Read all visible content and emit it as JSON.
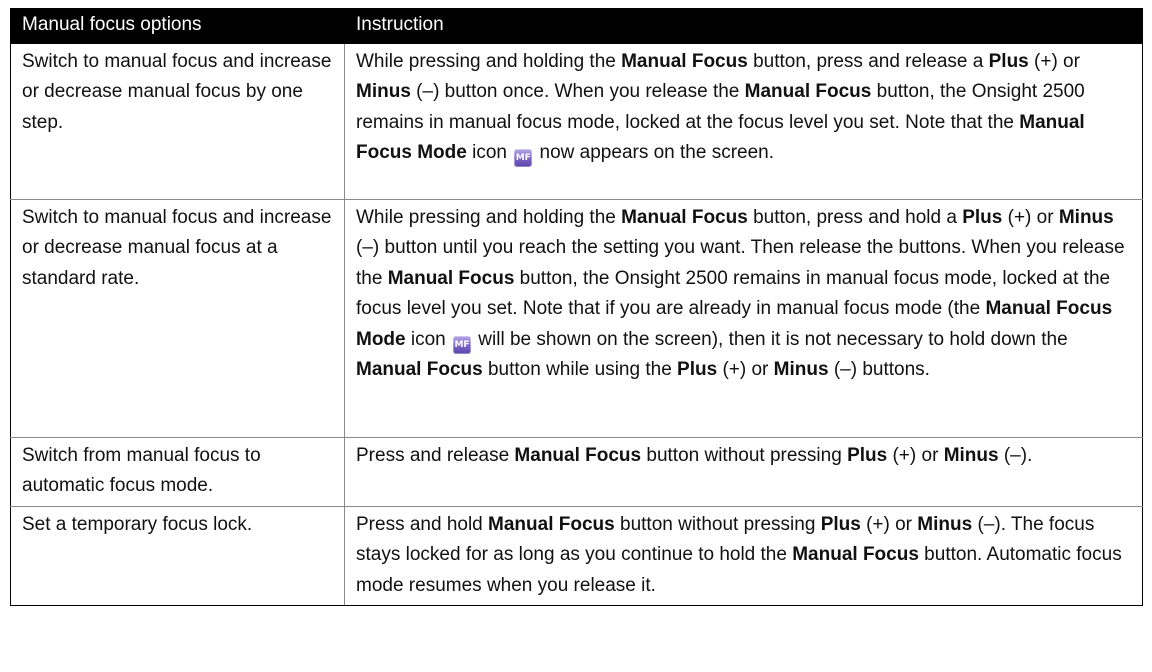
{
  "header": {
    "col1": "Manual focus options",
    "col2": "Instruction"
  },
  "icon_text": "MF",
  "rows": [
    {
      "option": "Switch to manual focus and increase or decrease manual focus by one step.",
      "t": [
        "While pressing and holding the ",
        "Manual Focus",
        " button, press and release a ",
        "Plus",
        " (+) or ",
        "Minus",
        " (–) button once. When you release the ",
        "Manual Focus",
        " button, the Onsight 2500 remains in manual focus mode, locked at the focus level you set. Note that the ",
        "Manual Focus Mode",
        " icon ",
        " now appears on the screen."
      ]
    },
    {
      "option": "Switch to manual focus and increase or decrease manual focus at a standard rate.",
      "t": [
        "While pressing and holding the ",
        "Manual Focus",
        " button, press and hold a ",
        "Plus",
        " (+) or ",
        "Minus",
        " (–) button until you reach the setting you want. Then release the buttons. When you release the ",
        "Manual Focus",
        " button, the Onsight 2500 remains in manual focus mode, locked at the focus level you set. Note that if you are already in manual focus mode (the ",
        "Manual Focus Mode",
        " icon ",
        " will be shown on the screen), then it is not necessary to hold down the ",
        "Manual Focus",
        " button while using the ",
        "Plus",
        " (+) or ",
        "Minus",
        " (–) buttons."
      ]
    },
    {
      "option": "Switch from manual focus to automatic focus mode.",
      "t": [
        "Press and release ",
        "Manual Focus",
        " button without pressing ",
        "Plus",
        " (+) or ",
        "Minus",
        " (–)."
      ]
    },
    {
      "option": "Set a temporary focus lock.",
      "t": [
        "Press and hold ",
        "Manual Focus",
        " button without pressing ",
        "Plus",
        " (+) or ",
        "Minus",
        " (–). The focus stays locked for as long as you continue to hold the ",
        "Manual Focus",
        " button. Automatic focus mode resumes when you release it."
      ]
    }
  ]
}
